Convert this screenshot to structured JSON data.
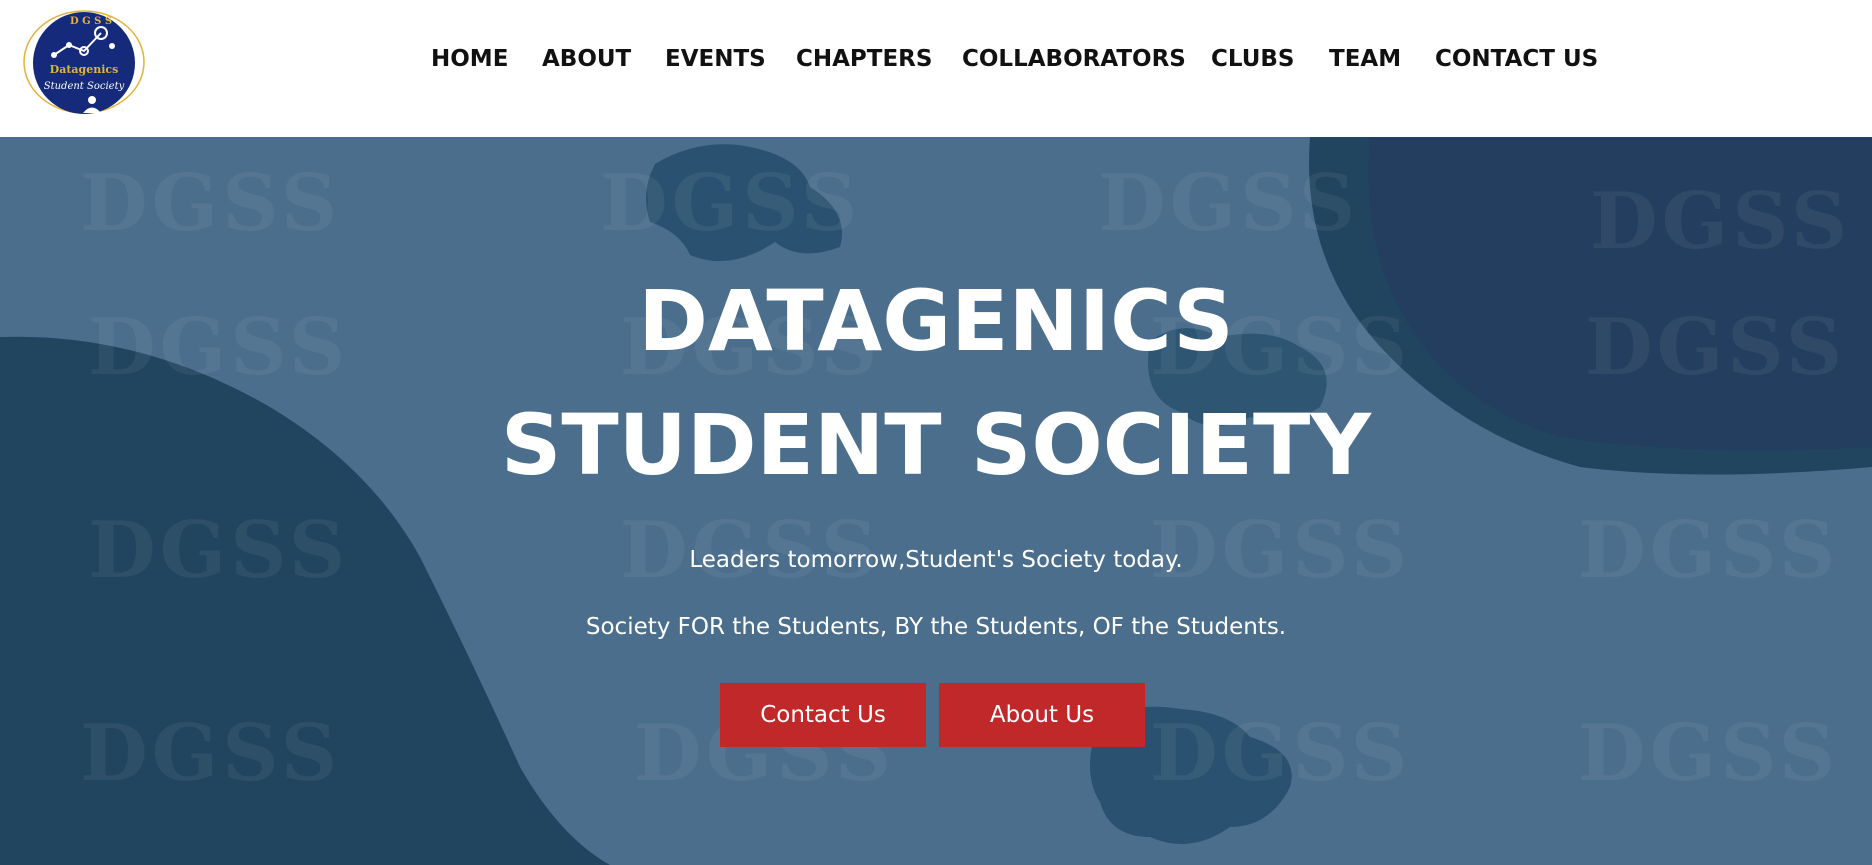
{
  "logo": {
    "letters": "D G S S",
    "line1": "Datagenics",
    "line2": "Student Society"
  },
  "nav": {
    "items": [
      "HOME",
      "ABOUT",
      "EVENTS",
      "CHAPTERS",
      "COLLABORATORS",
      "CLUBS",
      "TEAM",
      "CONTACT US"
    ]
  },
  "hero": {
    "watermark": "DGSS",
    "title_line1": "DATAGENICS",
    "title_line2": "STUDENT SOCIETY",
    "tagline1": "Leaders tomorrow,Student's Society today.",
    "tagline2": "Society FOR the Students, BY the Students, OF the Students.",
    "buttons": {
      "contact": "Contact Us",
      "about": "About Us"
    }
  },
  "colors": {
    "hero_bg": "#4a6e8c",
    "shape_dark": "#21455f",
    "shape_navy": "#243d5e",
    "button": "#c0282a",
    "logo_circle": "#152a7a",
    "logo_ring": "#e2b23a"
  }
}
